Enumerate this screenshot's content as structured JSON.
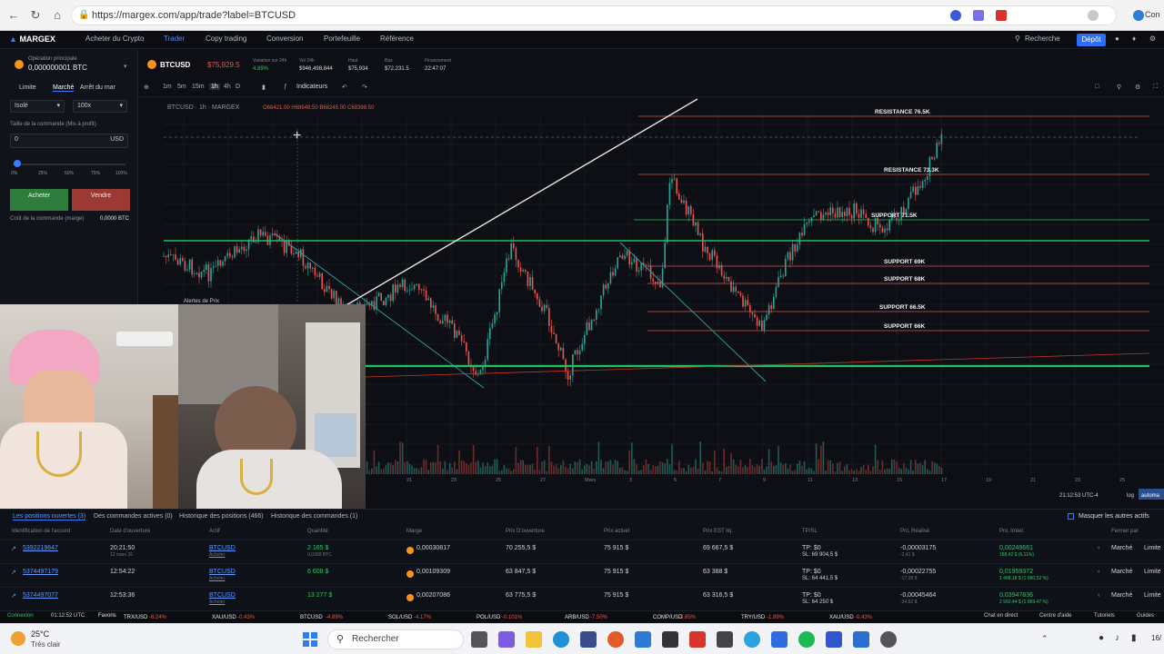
{
  "browser": {
    "url": "https://margex.com/app/trade?label=BTCUSD",
    "profile_label": "Con"
  },
  "nav": {
    "logo": "MARGEX",
    "items": [
      "Acheter du Crypto",
      "Trader",
      "Copy trading",
      "Conversion",
      "Portefeuille",
      "Référence"
    ],
    "search": "Recherche",
    "deposit": "Dépôt"
  },
  "left_panel": {
    "op_label": "Opération principale",
    "balance": "0,000000001 BTC",
    "tabs": [
      "Limite",
      "Marché",
      "Arrêt du mar"
    ],
    "margin_mode": "Isolé",
    "leverage": "100x",
    "cost_label": "Taille de la commande (Mis à profit)",
    "qty": "0",
    "currency": "USD",
    "slider_marks": [
      "0%",
      "25%",
      "50%",
      "75%",
      "100%"
    ],
    "buy_label": "Acheter",
    "sell_label": "Vendre",
    "order_cost_label": "Coût de la commande (marge)",
    "order_cost_value": "0,0000 BTC"
  },
  "chart": {
    "symbol": "BTCUSD",
    "price": "$75,929.5",
    "stats": [
      {
        "label": "Variation sur 24h",
        "value": "4.89%"
      },
      {
        "label": "Vol 24h",
        "value": "$946,498,844"
      },
      {
        "label": "Haut",
        "value": "$75,934"
      },
      {
        "label": "Bas",
        "value": "$72,231.5"
      },
      {
        "label": "Financement",
        "value": "22:47:07"
      }
    ],
    "timeframes": [
      "1m",
      "5m",
      "15m",
      "1h",
      "4h",
      "D"
    ],
    "indicators_label": "Indicateurs",
    "legend": "BTCUSD · 1h · MARGEX",
    "ohlc": "O68421.00 H68649.50 B68245.00 C68398.50",
    "alerts_label": "Alertes de Prix",
    "clock": "21:12:53 UTC-4",
    "log_label": "log",
    "auto_label": "automa",
    "levels": [
      "RESISTANCE 76.5K",
      "RESISTANCE 73.3K",
      "SUPPORT 71.5K",
      "SUPPORT 69K",
      "SUPPORT 68K",
      "SUPPORT 66.5K",
      "SUPPORT 66K"
    ],
    "xticks": [
      "21",
      "23",
      "25",
      "27",
      "Mars",
      "3",
      "5",
      "7",
      "9",
      "11",
      "13",
      "15",
      "17",
      "19",
      "21",
      "23",
      "25"
    ],
    "colors": {
      "up": "#26a69a",
      "down": "#ef5350",
      "support": "#d9534f",
      "green_line": "#21c25e"
    }
  },
  "bottom": {
    "tabs": [
      "Les positions ouvertes (3)",
      "Des commandes actives (0)",
      "Historique des positions (466)",
      "Historique des commandes (1)"
    ],
    "hide_label": "Masquer les autres actifs",
    "headers": [
      "Identification de l'accord",
      "Date d'ouverture",
      "Actif",
      "Quantité",
      "Marge",
      "Prix D'ouverture",
      "Prix actuel",
      "Prix EST liq.",
      "TP/SL",
      "PnL Réalisé",
      "PnL Irréel.",
      "Fermer par"
    ],
    "rows": [
      {
        "id": "5392219647",
        "time": "20:21:50",
        "date": "12 mars 26",
        "asset": "BTCUSD",
        "side": "Acheter",
        "qty": "2 165 $",
        "qty_sub": "0,0308 BTC",
        "margin": "0,00030817",
        "open": "70 255,5 $",
        "current": "75 915 $",
        "liq": "69 667,5 $",
        "tp": "TP: $0",
        "sl": "SL: 69 904,5 $",
        "pnl": "-0,00003175",
        "pnl_sub": "-2,41 $",
        "upnl": "0,00249661",
        "upnl_sub": "188,42 $ (6,11%)"
      },
      {
        "id": "5374497179",
        "time": "12:54:22",
        "date": "",
        "asset": "BTCUSD",
        "side": "Acheter",
        "qty": "6 608 $",
        "qty_sub": "",
        "margin": "0,00109309",
        "open": "63 847,5 $",
        "current": "75 915 $",
        "liq": "63 388 $",
        "tp": "TP: $0",
        "sl": "SL: 64 441,5 $",
        "pnl": "-0,00022755",
        "pnl_sub": "-17,28 $",
        "upnl": "0,01959372",
        "upnl_sub": "1 488,18 $ (1 880,52 %)"
      },
      {
        "id": "5374497077",
        "time": "12:53:36",
        "date": "",
        "asset": "BTCUSD",
        "side": "Acheter",
        "qty": "13 277 $",
        "qty_sub": "",
        "margin": "0,00207086",
        "open": "63 775,5 $",
        "current": "75 915 $",
        "liq": "63 316,5 $",
        "tp": "TP: $0",
        "sl": "SL: 64 250 $",
        "pnl": "-0,00045464",
        "pnl_sub": "-34,52 $",
        "upnl": "0,03947836",
        "upnl_sub": "2 992,44 $ (1 869,47 %)"
      }
    ],
    "close_market": "Marché",
    "close_limit": "Limite"
  },
  "ticker": {
    "connection": "Connexion",
    "time": "01:12:52 UTC",
    "favorites": "Favoris",
    "items": [
      {
        "sym": "TRX/USD",
        "chg": "-6.24%"
      },
      {
        "sym": "XAU/USD",
        "chg": "-0.43%"
      },
      {
        "sym": "BTCUSD",
        "chg": "-4.89%"
      },
      {
        "sym": "SOL/USD",
        "chg": "-4.17%"
      },
      {
        "sym": "POL/USD",
        "chg": "-0.101%"
      },
      {
        "sym": "ARB/USD",
        "chg": "-7.50%"
      },
      {
        "sym": "COMP/USD",
        "chg": "-3.85%"
      },
      {
        "sym": "TRY/USD",
        "chg": "-1.89%"
      },
      {
        "sym": "XAU/USD",
        "chg": "-0.43%"
      }
    ],
    "chat": "Chat en direct",
    "help": "Centre d'aide",
    "tutorials": "Tutoriels",
    "guides": "Guides"
  },
  "taskbar": {
    "weather_temp": "25°C",
    "weather_desc": "Très clair",
    "search": "Rechercher",
    "time": "16/"
  }
}
